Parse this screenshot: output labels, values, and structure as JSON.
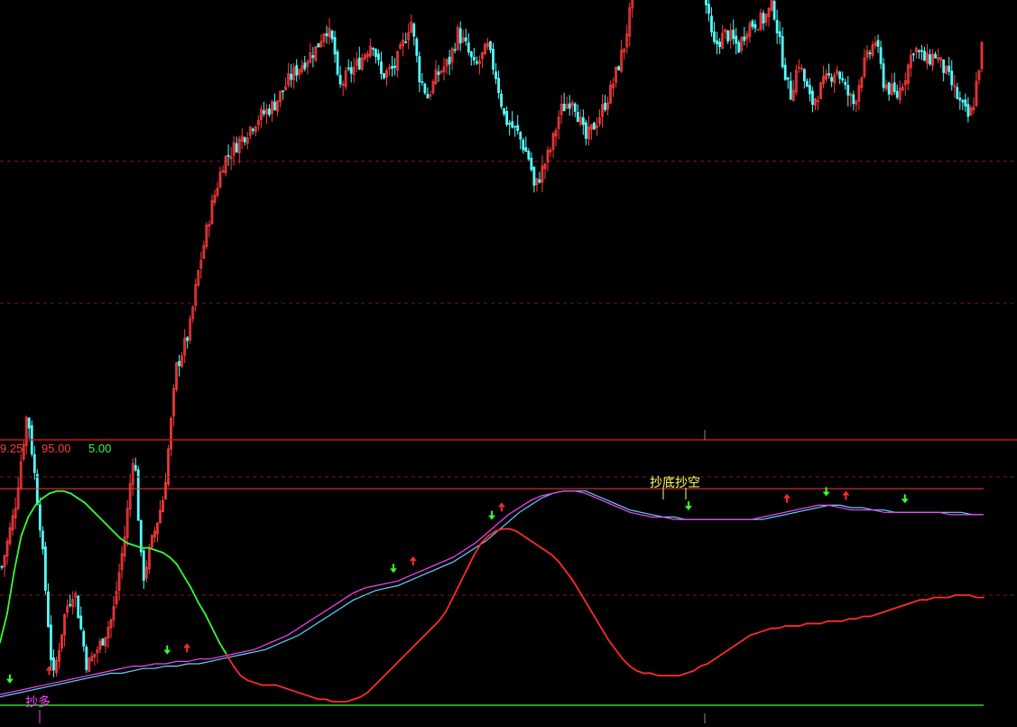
{
  "colors": {
    "background": "#000000",
    "candle_up": "#ff3b3b",
    "candle_down": "#54ffff",
    "separator": "#c8141e",
    "dashed_grid": "#7a1a1a",
    "band_line": "#ff3b3b",
    "osc_up": "#ff2a2a",
    "osc_down": "#33ff33",
    "ma_fast": "#ff44ff",
    "ma_slow": "#5ad8ff",
    "bottom_line": "#33ff33",
    "label_yellow": "#ffff66",
    "label_magenta": "#ff44ff",
    "readout_red": "#ff3b3b",
    "readout_green": "#33ff33"
  },
  "indicator_readout": {
    "v1": "9.25",
    "v2": "95.00",
    "v3": "5.00"
  },
  "labels": {
    "top_signal": "抄底抄空",
    "bottom_signal": "抄多"
  },
  "chart_data": [
    {
      "type": "candlestick",
      "title": "",
      "xlabel": "",
      "ylabel": "",
      "grid": true,
      "path_points": [
        [
          0,
          58
        ],
        [
          3,
          66
        ],
        [
          6,
          80
        ],
        [
          9,
          64
        ],
        [
          12,
          42
        ],
        [
          15,
          52
        ],
        [
          17,
          55
        ],
        [
          20,
          44
        ],
        [
          23,
          47
        ],
        [
          26,
          51
        ],
        [
          29,
          63
        ],
        [
          31,
          75
        ],
        [
          33,
          56
        ],
        [
          35,
          61
        ],
        [
          38,
          68
        ],
        [
          41,
          86
        ],
        [
          44,
          91
        ],
        [
          46,
          99
        ],
        [
          49,
          108
        ],
        [
          52,
          115
        ],
        [
          56,
          118
        ],
        [
          60,
          121
        ],
        [
          64,
          123
        ],
        [
          68,
          127
        ],
        [
          71,
          129
        ],
        [
          74,
          131
        ],
        [
          76,
          134
        ],
        [
          78,
          131
        ],
        [
          79,
          125
        ],
        [
          81,
          127
        ],
        [
          84,
          129
        ],
        [
          87,
          132
        ],
        [
          89,
          127
        ],
        [
          92,
          128
        ],
        [
          94,
          131
        ],
        [
          96,
          135
        ],
        [
          98,
          127
        ],
        [
          100,
          124
        ],
        [
          102,
          127
        ],
        [
          105,
          129
        ],
        [
          107,
          133
        ],
        [
          109,
          131
        ],
        [
          111,
          128
        ],
        [
          114,
          131
        ],
        [
          116,
          127
        ],
        [
          118,
          121
        ],
        [
          121,
          119
        ],
        [
          124,
          115
        ],
        [
          125,
          111
        ],
        [
          129,
          117
        ],
        [
          131,
          122
        ],
        [
          134,
          124
        ],
        [
          137,
          118
        ],
        [
          140,
          121
        ],
        [
          143,
          125
        ],
        [
          146,
          131
        ],
        [
          149,
          141
        ],
        [
          152,
          146
        ],
        [
          155,
          153
        ],
        [
          158,
          149
        ],
        [
          160,
          143
        ],
        [
          163,
          146
        ],
        [
          165,
          138
        ],
        [
          167,
          131
        ],
        [
          170,
          133
        ],
        [
          173,
          131
        ],
        [
          175,
          134
        ],
        [
          179,
          135
        ],
        [
          181,
          137
        ],
        [
          183,
          130
        ],
        [
          185,
          124
        ],
        [
          187,
          129
        ],
        [
          190,
          123
        ],
        [
          193,
          126
        ],
        [
          196,
          128
        ],
        [
          198,
          125
        ],
        [
          200,
          123
        ],
        [
          202,
          128
        ],
        [
          205,
          132
        ],
        [
          207,
          126
        ],
        [
          210,
          124
        ],
        [
          212,
          127
        ],
        [
          214,
          131
        ],
        [
          217,
          129
        ],
        [
          219,
          130
        ],
        [
          222,
          127
        ],
        [
          225,
          123
        ],
        [
          227,
          121
        ],
        [
          228,
          123
        ],
        [
          230,
          131
        ]
      ],
      "scale_levels": {
        "dashed_upper": 115,
        "dashed_lower": 95,
        "price_min": 78,
        "price_max": 137
      }
    },
    {
      "type": "line",
      "title": "",
      "xlabel": "",
      "ylabel": "",
      "ylim": [
        0,
        100
      ],
      "bands": [
        95,
        5
      ],
      "dashed_levels": [
        100,
        50
      ],
      "series": [
        {
          "role": "oscillator",
          "color_rule": "green when rising above fast average, red otherwise",
          "values": [
            30,
            42,
            60,
            75,
            83,
            88,
            91,
            93,
            94,
            94,
            93,
            91,
            89,
            86,
            83,
            80,
            77,
            74,
            72,
            71,
            70,
            70,
            69,
            68,
            66,
            63,
            58,
            53,
            47,
            42,
            36,
            30,
            25,
            20,
            16,
            14,
            13,
            12,
            12,
            12,
            11,
            10,
            9,
            8,
            7,
            6,
            6,
            5,
            5,
            5,
            6,
            7,
            9,
            12,
            15,
            18,
            21,
            24,
            27,
            30,
            33,
            36,
            39,
            43,
            49,
            55,
            61,
            67,
            72,
            75,
            77,
            78,
            78,
            77,
            75,
            73,
            71,
            69,
            67,
            64,
            60,
            56,
            51,
            46,
            41,
            36,
            31,
            27,
            23,
            20,
            18,
            17,
            17,
            16,
            16,
            16,
            16,
            17,
            18,
            20,
            21,
            23,
            25,
            27,
            29,
            31,
            33,
            34,
            35,
            36,
            36,
            37,
            37,
            37,
            38,
            38,
            38,
            39,
            39,
            39,
            40,
            40,
            41,
            41,
            42,
            43,
            44,
            45,
            46,
            47,
            48,
            48,
            49,
            49,
            49,
            50,
            50,
            50,
            49,
            49
          ]
        },
        {
          "role": "fast_average",
          "values": [
            8,
            9,
            10,
            11,
            12,
            13,
            14,
            15,
            16,
            17,
            18,
            19,
            20,
            20,
            21,
            21,
            22,
            22,
            23,
            23,
            24,
            25,
            26,
            27,
            29,
            31,
            33,
            36,
            39,
            42,
            45,
            48,
            51,
            53,
            54,
            55,
            56,
            58,
            60,
            62,
            64,
            66,
            69,
            72,
            76,
            80,
            84,
            87,
            90,
            92,
            93,
            94,
            94,
            93,
            91,
            89,
            87,
            85,
            84,
            83,
            83,
            82,
            82,
            82,
            82,
            82,
            82,
            82,
            82,
            83,
            84,
            85,
            86,
            87,
            88,
            88,
            87,
            86,
            86,
            86,
            85,
            85,
            85,
            85,
            85,
            85,
            84,
            84,
            84,
            84
          ]
        },
        {
          "role": "slow_average",
          "values": [
            7,
            8,
            9,
            10,
            11,
            12,
            13,
            14,
            15,
            16,
            17,
            17,
            18,
            19,
            19,
            20,
            20,
            21,
            21,
            22,
            23,
            24,
            25,
            26,
            27,
            29,
            31,
            33,
            36,
            39,
            42,
            45,
            48,
            50,
            52,
            53,
            54,
            56,
            58,
            60,
            62,
            64,
            67,
            70,
            73,
            77,
            81,
            85,
            88,
            91,
            93,
            94,
            94,
            94,
            92,
            90,
            88,
            86,
            85,
            84,
            83,
            83,
            82,
            82,
            82,
            82,
            82,
            82,
            82,
            82,
            83,
            84,
            85,
            86,
            87,
            88,
            88,
            87,
            87,
            86,
            86,
            85,
            85,
            85,
            85,
            85,
            85,
            85,
            84,
            84
          ]
        }
      ],
      "signals": [
        {
          "kind": "buy",
          "at": 0.01
        },
        {
          "kind": "sell",
          "at": 0.05
        },
        {
          "kind": "buy",
          "at": 0.17
        },
        {
          "kind": "sell",
          "at": 0.19
        },
        {
          "kind": "buy",
          "at": 0.4
        },
        {
          "kind": "sell",
          "at": 0.42
        },
        {
          "kind": "buy",
          "at": 0.5
        },
        {
          "kind": "sell",
          "at": 0.51
        },
        {
          "kind": "buy",
          "at": 0.7
        },
        {
          "kind": "sell",
          "at": 0.8
        },
        {
          "kind": "buy",
          "at": 0.84
        },
        {
          "kind": "sell",
          "at": 0.86
        },
        {
          "kind": "buy",
          "at": 0.92
        }
      ]
    }
  ]
}
